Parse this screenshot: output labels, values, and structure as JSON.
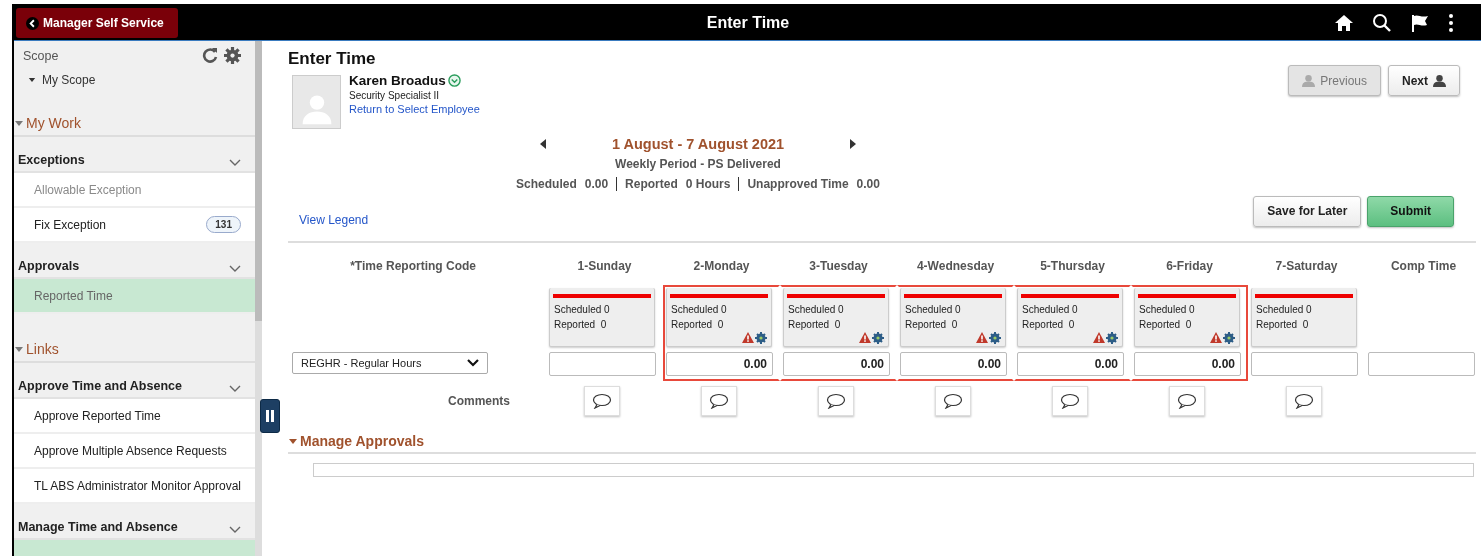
{
  "header": {
    "back_button": "Manager Self Service",
    "title": "Enter Time"
  },
  "sidebar": {
    "scope_label": "Scope",
    "scope_item": "My Scope",
    "sections": [
      {
        "title": "My Work",
        "expanded": true,
        "groups": [
          {
            "title": "Exceptions",
            "items": [
              {
                "label": "Allowable Exception",
                "selected": false,
                "disabled": true
              },
              {
                "label": "Fix Exception",
                "badge": "131",
                "selected": false,
                "disabled": false
              }
            ]
          },
          {
            "title": "Approvals",
            "items": [
              {
                "label": "Reported Time",
                "selected": true,
                "disabled": false
              }
            ]
          }
        ]
      },
      {
        "title": "Links",
        "expanded": true,
        "groups": [
          {
            "title": "Approve Time and Absence",
            "items": [
              {
                "label": "Approve Reported Time",
                "selected": false,
                "disabled": false
              },
              {
                "label": "Approve Multiple Absence Requests",
                "selected": false,
                "disabled": false
              },
              {
                "label": "TL ABS Administrator Monitor Approval",
                "selected": false,
                "disabled": false
              }
            ]
          },
          {
            "title": "Manage Time and Absence",
            "items": [
              {
                "selected": true,
                "disabled": false
              }
            ]
          }
        ]
      }
    ]
  },
  "main": {
    "title": "Enter Time",
    "employee": {
      "name": "Karen Broadus",
      "job": "Security Specialist II",
      "return_link": "Return to Select Employee"
    },
    "nav_buttons": [
      {
        "label": "Previous",
        "disabled": true
      },
      {
        "label": "Next",
        "disabled": false
      }
    ],
    "period": {
      "dates": "1 August - 7 August 2021",
      "type": "Weekly Period - PS Delivered"
    },
    "summary": [
      {
        "label": "Scheduled",
        "value": "0.00"
      },
      {
        "label": "Reported",
        "value": "0 Hours"
      },
      {
        "label": "Unapproved Time",
        "value": "0.00"
      }
    ],
    "view_legend": "View Legend",
    "actions": [
      {
        "label": "Save for Later",
        "kind": "secondary"
      },
      {
        "label": "Submit",
        "kind": "primary"
      }
    ],
    "grid": {
      "code_header": "*Time Reporting Code",
      "code_value": "REGHR - Regular Hours",
      "comments_label": "Comments",
      "days": [
        {
          "label": "1-Sunday",
          "scheduled": "Scheduled 0",
          "reported": "Reported  0",
          "warning": false,
          "highlighted": false
        },
        {
          "label": "2-Monday",
          "scheduled": "Scheduled 0",
          "reported": "Reported  0",
          "hours": "0.00",
          "warning": true,
          "highlighted": true
        },
        {
          "label": "3-Tuesday",
          "scheduled": "Scheduled 0",
          "reported": "Reported  0",
          "hours": "0.00",
          "warning": true,
          "highlighted": true
        },
        {
          "label": "4-Wednesday",
          "scheduled": "Scheduled 0",
          "reported": "Reported  0",
          "hours": "0.00",
          "warning": true,
          "highlighted": true
        },
        {
          "label": "5-Thursday",
          "scheduled": "Scheduled 0",
          "reported": "Reported  0",
          "hours": "0.00",
          "warning": true,
          "highlighted": true
        },
        {
          "label": "6-Friday",
          "scheduled": "Scheduled 0",
          "reported": "Reported  0",
          "hours": "0.00",
          "warning": true,
          "highlighted": true
        },
        {
          "label": "7-Saturday",
          "scheduled": "Scheduled 0",
          "reported": "Reported  0",
          "warning": false,
          "highlighted": false
        }
      ],
      "extra_column": "Comp Time"
    },
    "section": {
      "title": "Manage Approvals",
      "expanded": true
    }
  }
}
